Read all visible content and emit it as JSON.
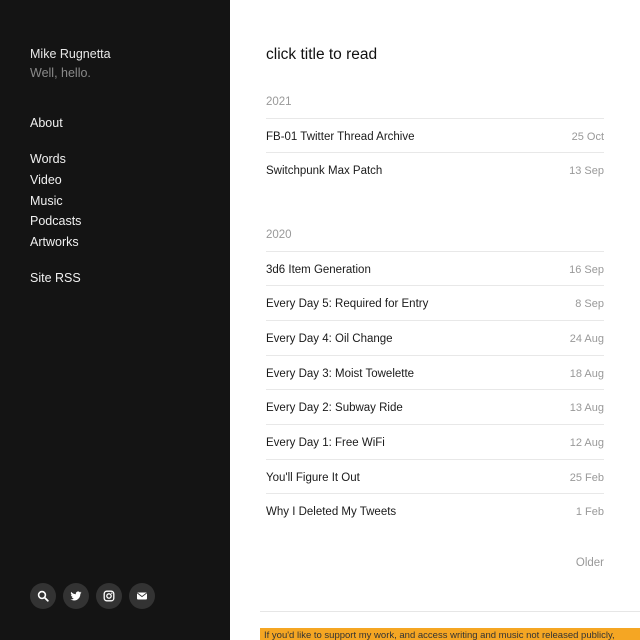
{
  "site": {
    "name": "Mike Rugnetta",
    "tagline": "Well, hello."
  },
  "nav": {
    "about": "About",
    "words": "Words",
    "video": "Video",
    "music": "Music",
    "podcasts": "Podcasts",
    "artworks": "Artworks",
    "rss": "Site RSS"
  },
  "socials": [
    "search-icon",
    "twitter-icon",
    "instagram-icon",
    "email-icon"
  ],
  "main": {
    "title": "click title to read",
    "groups": [
      {
        "year": "2021",
        "posts": [
          {
            "title": "FB-01 Twitter Thread Archive",
            "date": "25 Oct"
          },
          {
            "title": "Switchpunk Max Patch",
            "date": "13 Sep"
          }
        ]
      },
      {
        "year": "2020",
        "posts": [
          {
            "title": "3d6 Item Generation",
            "date": "16 Sep"
          },
          {
            "title": "Every Day 5: Required for Entry",
            "date": "8 Sep"
          },
          {
            "title": "Every Day 4: Oil Change",
            "date": "24 Aug"
          },
          {
            "title": "Every Day 3: Moist Towelette",
            "date": "18 Aug"
          },
          {
            "title": "Every Day 2: Subway Ride",
            "date": "13 Aug"
          },
          {
            "title": "Every Day 1: Free WiFi",
            "date": "12 Aug"
          },
          {
            "title": "You'll Figure It Out",
            "date": "25 Feb"
          },
          {
            "title": "Why I Deleted My Tweets",
            "date": "1 Feb"
          }
        ]
      }
    ],
    "older": "Older",
    "support_text": "If you'd like to support my work, and access writing and music not released publicly,"
  },
  "colors": {
    "sidebar_bg": "#141414",
    "social_bg": "#333333",
    "support_bg": "#f5a623"
  }
}
